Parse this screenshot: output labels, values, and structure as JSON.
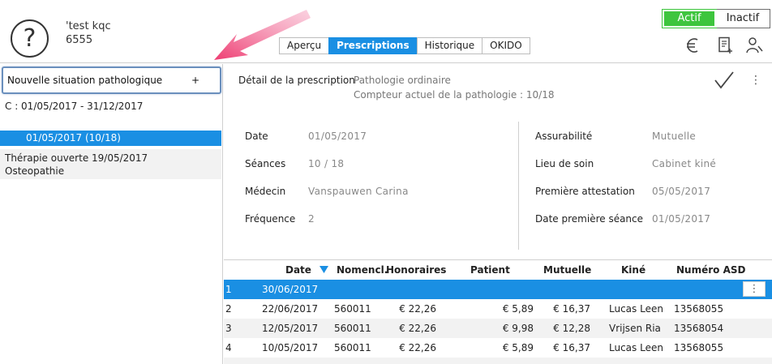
{
  "header": {
    "patient_name": "'test kqc",
    "patient_id": "6555",
    "tabs": [
      {
        "label": "Aperçu",
        "active": false
      },
      {
        "label": "Prescriptions",
        "active": true
      },
      {
        "label": "Historique",
        "active": false
      },
      {
        "label": "OKIDO",
        "active": false
      }
    ],
    "status": {
      "active_label": "Actif",
      "inactive_label": "Inactif",
      "selected": "Actif"
    },
    "icons": [
      "euro-icon",
      "document-icon",
      "user-search-icon"
    ]
  },
  "left": {
    "new_situation_label": "Nouvelle situation pathologique",
    "new_situation_plus": "+",
    "episode_range": "C : 01/05/2017 - 31/12/2017",
    "selected_episode": "01/05/2017  (10/18)",
    "therapy_line1": "Thérapie ouverte 19/05/2017",
    "therapy_line2": "Osteopathie"
  },
  "detail": {
    "title": "Détail de la prescription",
    "pathology_type": "Pathologie ordinaire",
    "pathology_counter": "Compteur actuel de la pathologie : 10/18",
    "left_fields": [
      {
        "label": "Date",
        "value": "01/05/2017"
      },
      {
        "label": "Séances",
        "value": "10 / 18"
      },
      {
        "label": "Médecin",
        "value": "Vanspauwen Carina"
      },
      {
        "label": "Fréquence",
        "value": "2"
      }
    ],
    "right_fields": [
      {
        "label": "Assurabilité",
        "value": "Mutuelle"
      },
      {
        "label": "Lieu de soin",
        "value": "Cabinet kiné"
      },
      {
        "label": "Première attestation",
        "value": "05/05/2017"
      },
      {
        "label": "Date première séance",
        "value": "01/05/2017"
      }
    ]
  },
  "table": {
    "columns": [
      "Date",
      "Nomencl.",
      "Honoraires",
      "Patient",
      "Mutuelle",
      "Kiné",
      "Numéro ASD"
    ],
    "rows": [
      {
        "n": "1",
        "date": "30/06/2017",
        "nomencl": "",
        "honoraires": "",
        "patient": "",
        "mutuelle": "",
        "kine": "",
        "asd": ""
      },
      {
        "n": "2",
        "date": "22/06/2017",
        "nomencl": "560011",
        "honoraires": "€ 22,26",
        "patient": "€ 5,89",
        "mutuelle": "€ 16,37",
        "kine": "Lucas Leen",
        "asd": "13568055"
      },
      {
        "n": "3",
        "date": "12/05/2017",
        "nomencl": "560011",
        "honoraires": "€ 22,26",
        "patient": "€ 9,98",
        "mutuelle": "€ 12,28",
        "kine": "Vrijsen Ria",
        "asd": "13568054"
      },
      {
        "n": "4",
        "date": "10/05/2017",
        "nomencl": "560011",
        "honoraires": "€ 22,26",
        "patient": "€ 5,89",
        "mutuelle": "€ 16,37",
        "kine": "Lucas Leen",
        "asd": "13568055"
      }
    ]
  },
  "colors": {
    "accent": "#1a8fe3",
    "active_green": "#3ec53e",
    "arrow": "#f0457a"
  }
}
